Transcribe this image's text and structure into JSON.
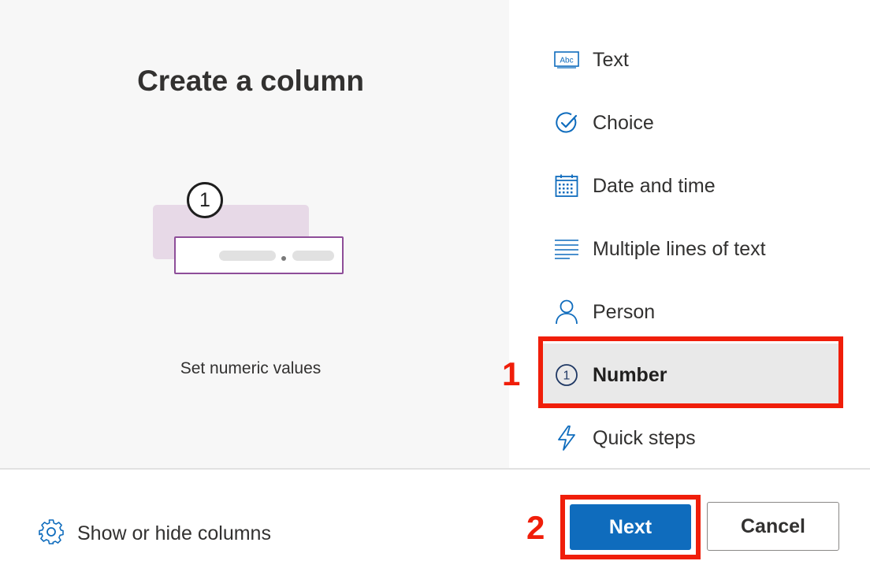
{
  "preview": {
    "title": "Create a column",
    "illustration_badge": "1",
    "description": "Set numeric values"
  },
  "column_types": [
    {
      "label": "Text",
      "icon": "text-abc-icon",
      "selected": false
    },
    {
      "label": "Choice",
      "icon": "choice-check-icon",
      "selected": false
    },
    {
      "label": "Date and time",
      "icon": "calendar-icon",
      "selected": false
    },
    {
      "label": "Multiple lines of text",
      "icon": "multiline-text-icon",
      "selected": false
    },
    {
      "label": "Person",
      "icon": "person-icon",
      "selected": false
    },
    {
      "label": "Number",
      "icon": "number-circle-icon",
      "selected": true
    },
    {
      "label": "Quick steps",
      "icon": "lightning-icon",
      "selected": false
    }
  ],
  "icons": {
    "text_abc": "Abc",
    "number_circle": "1"
  },
  "annotations": {
    "step1": "1",
    "step2": "2",
    "color": "#f01e0a"
  },
  "footer": {
    "show_hide_label": "Show or hide columns",
    "next_label": "Next",
    "cancel_label": "Cancel"
  },
  "colors": {
    "accent": "#0f6cbd",
    "icon": "#0f6cbd",
    "illustration_border": "#8e4e99"
  }
}
